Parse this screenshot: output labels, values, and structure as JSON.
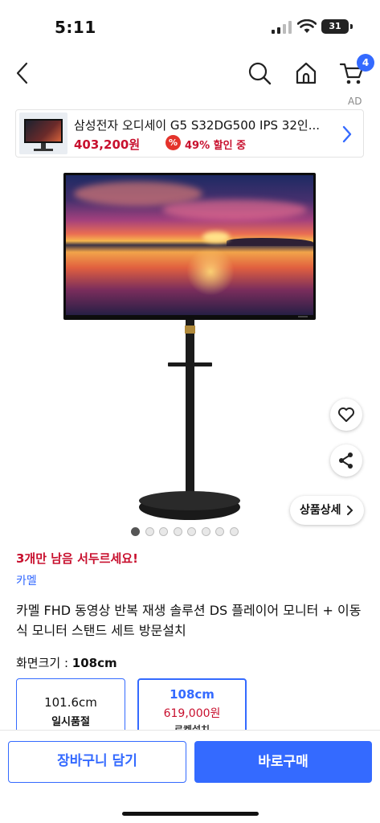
{
  "status": {
    "time": "5:11",
    "battery": "31"
  },
  "nav": {
    "cart_count": "4",
    "ad_label": "AD"
  },
  "ad": {
    "title": "삼성전자 오디세이 G5 S32DG500 IPS 32인...",
    "price": "403,200원",
    "discount_icon": "%",
    "discount": "49% 할인 중"
  },
  "gallery": {
    "detail_button": "상품상세",
    "dot_count": 8,
    "active_dot": 0
  },
  "product": {
    "stock_warning": "3개만 남음 서두르세요!",
    "brand": "카멜",
    "title": "카멜 FHD 동영상 반복 재생 솔루션 DS 플레이어 모니터 + 이동식 모니터 스탠드 세트 방문설치",
    "option_label": "화면크기 : ",
    "option_value": "108cm",
    "options": [
      {
        "size": "101.6cm",
        "status": "일시품절"
      },
      {
        "size": "108cm",
        "price": "619,000원",
        "delivery": "로켓설치"
      }
    ]
  },
  "actions": {
    "cart": "장바구니 담기",
    "buy": "바로구매"
  },
  "colors": {
    "accent": "#346aff",
    "sale": "#c8102e"
  }
}
